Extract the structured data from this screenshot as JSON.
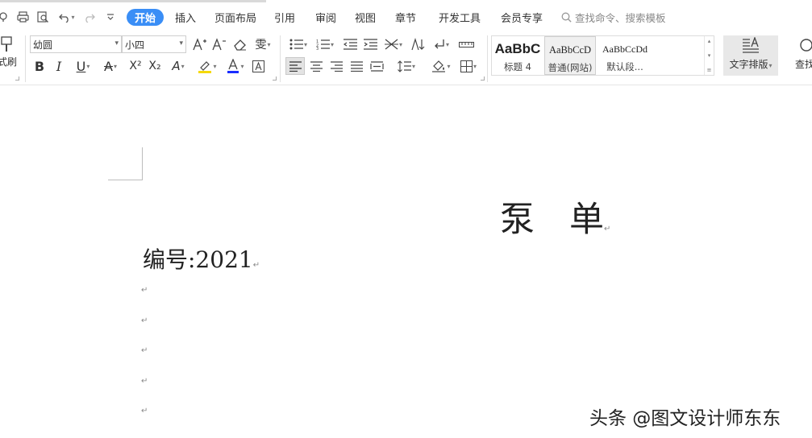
{
  "menu": {
    "tabs": [
      {
        "label": "开始",
        "active": true
      },
      {
        "label": "插入",
        "active": false
      },
      {
        "label": "页面布局",
        "active": false
      },
      {
        "label": "引用",
        "active": false
      },
      {
        "label": "审阅",
        "active": false
      },
      {
        "label": "视图",
        "active": false
      },
      {
        "label": "章节",
        "active": false
      },
      {
        "label": "开发工具",
        "active": false
      },
      {
        "label": "会员专享",
        "active": false
      }
    ],
    "search_placeholder": "查找命令、搜索模板"
  },
  "ribbon": {
    "format_painter_label": "式刷",
    "font_name": "幼圆",
    "font_size": "小四",
    "styles": [
      {
        "sample": "AaBbC",
        "name": "标题 4"
      },
      {
        "sample": "AaBbCcD",
        "name": "普通(网站)"
      },
      {
        "sample": "AaBbCcDd",
        "name": "默认段..."
      }
    ],
    "text_layout_label": "文字排版",
    "find_replace_label": "查找"
  },
  "document": {
    "title": "泵　单",
    "number_line": "编号:2021",
    "paragraph_mark": "↵"
  },
  "watermark": "头条 @图文设计师东东",
  "colors": {
    "accent": "#3a8ef6",
    "highlight": "#f5d90a",
    "font_color": "#1a2dff"
  }
}
